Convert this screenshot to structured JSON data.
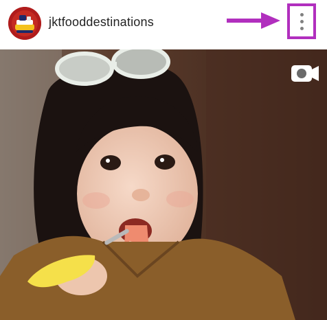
{
  "post": {
    "username": "jktfooddestinations",
    "media_type_icon": "video-camera-icon",
    "more_icon": "vertical-ellipsis-icon"
  },
  "colors": {
    "annotation": "#b12fbe",
    "avatar_red": "#b01c1c",
    "icon_gray": "#808080"
  }
}
